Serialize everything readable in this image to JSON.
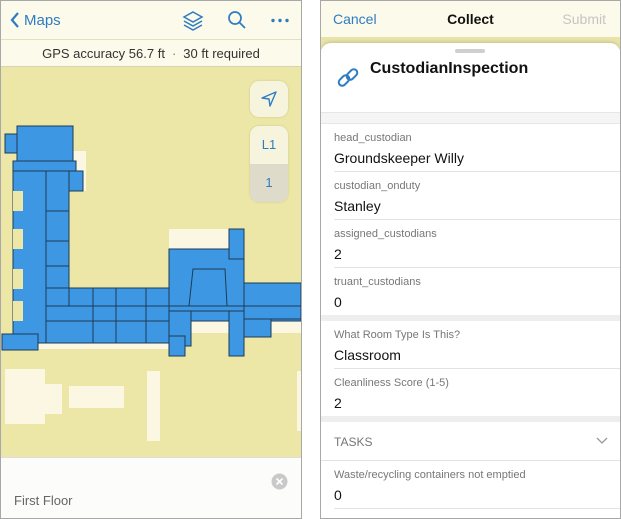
{
  "left": {
    "nav": {
      "back_label": "Maps",
      "icons": [
        "chevron-left-icon",
        "layers-icon",
        "search-icon",
        "more-icon"
      ]
    },
    "gps": {
      "accuracy": "GPS accuracy 56.7 ft",
      "dot": "·",
      "required": "30 ft required"
    },
    "floor_picker": {
      "levels": [
        "L1",
        "1"
      ],
      "selected": "1"
    },
    "bottom_card": {
      "title": "First Floor"
    },
    "colors": {
      "map_bg": "#ece7a6",
      "building": "#3d97e3",
      "accent": "#2e7cc2"
    }
  },
  "right": {
    "nav": {
      "cancel": "Cancel",
      "title": "Collect",
      "submit": "Submit"
    },
    "sheet": {
      "title": "CustodianInspection"
    },
    "fields": [
      {
        "label": "head_custodian",
        "value": "Groundskeeper Willy"
      },
      {
        "label": "custodian_onduty",
        "value": "Stanley"
      },
      {
        "label": "assigned_custodians",
        "value": "2"
      },
      {
        "label": "truant_custodians",
        "value": "0"
      }
    ],
    "fields2": [
      {
        "label": "What Room Type Is This?",
        "value": "Classroom"
      },
      {
        "label": "Cleanliness Score (1-5)",
        "value": "2"
      }
    ],
    "tasks": {
      "header": "TASKS",
      "fields": [
        {
          "label": "Waste/recycling containers not emptied",
          "value": "0"
        }
      ]
    }
  }
}
